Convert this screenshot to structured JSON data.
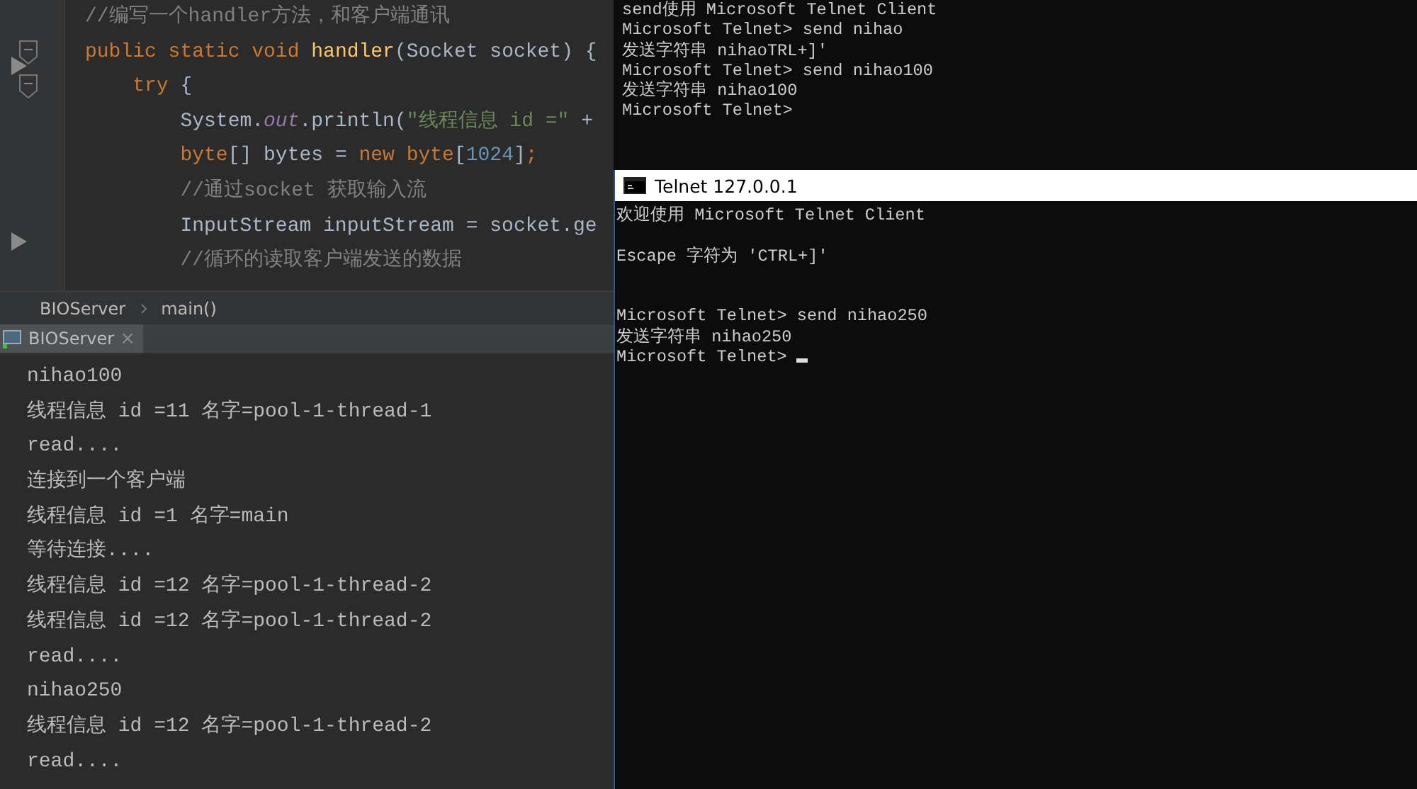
{
  "editor": {
    "lines": [
      {
        "tokens": [
          {
            "kind": "comment",
            "text": "//编写一个handler方法，和客户端通讯"
          }
        ]
      },
      {
        "tokens": [
          {
            "kind": "keyword",
            "text": "public static void "
          },
          {
            "kind": "method",
            "text": "handler"
          },
          {
            "kind": "plain",
            "text": "(Socket socket) {"
          }
        ]
      },
      {
        "tokens": [
          {
            "kind": "keyword",
            "text": "    try "
          },
          {
            "kind": "plain",
            "text": "{"
          }
        ]
      },
      {
        "tokens": [
          {
            "kind": "plain",
            "text": "        System."
          },
          {
            "kind": "field",
            "text": "out"
          },
          {
            "kind": "plain",
            "text": ".println("
          },
          {
            "kind": "string",
            "text": "\"线程信息 id =\""
          },
          {
            "kind": "plain",
            "text": " +"
          }
        ]
      },
      {
        "tokens": [
          {
            "kind": "keyword",
            "text": "        byte"
          },
          {
            "kind": "plain",
            "text": "[] bytes = "
          },
          {
            "kind": "keyword",
            "text": "new byte"
          },
          {
            "kind": "plain",
            "text": "["
          },
          {
            "kind": "number",
            "text": "1024"
          },
          {
            "kind": "plain",
            "text": "]"
          },
          {
            "kind": "keyword",
            "text": ";"
          }
        ]
      },
      {
        "tokens": [
          {
            "kind": "comment",
            "text": "        //通过socket 获取输入流"
          }
        ]
      },
      {
        "tokens": [
          {
            "kind": "plain",
            "text": "        InputStream inputStream = socket.ge"
          }
        ]
      },
      {
        "tokens": [
          {
            "kind": "comment",
            "text": "        //循环的读取客户端发送的数据"
          }
        ]
      }
    ]
  },
  "breadcrumb": [
    "BIOServer",
    "main()"
  ],
  "run_tab": {
    "label": "BIOServer",
    "close": "×",
    "selected": true
  },
  "console": [
    "nihao100",
    "线程信息 id =11 名字=pool-1-thread-1",
    "read....",
    "连接到一个客户端",
    "线程信息 id =1 名字=main",
    "等待连接....",
    "线程信息 id =12 名字=pool-1-thread-2",
    "线程信息 id =12 名字=pool-1-thread-2",
    "read....",
    "nihao250",
    "线程信息 id =12 名字=pool-1-thread-2",
    "read...."
  ],
  "back_terminal": [
    "send使用 Microsoft Telnet Client",
    "Microsoft Telnet> send nihao",
    "发送字符串 nihaoTRL+]'",
    "Microsoft Telnet> send nihao100",
    "发送字符串 nihao100",
    "Microsoft Telnet>"
  ],
  "telnet_window": {
    "title": "Telnet 127.0.0.1",
    "blocks": [
      [
        "欢迎使用 Microsoft Telnet Client"
      ],
      [
        "Escape 字符为 'CTRL+]'"
      ],
      [
        "Microsoft Telnet> send nihao250",
        "发送字符串 nihao250",
        "Microsoft Telnet>"
      ]
    ]
  }
}
